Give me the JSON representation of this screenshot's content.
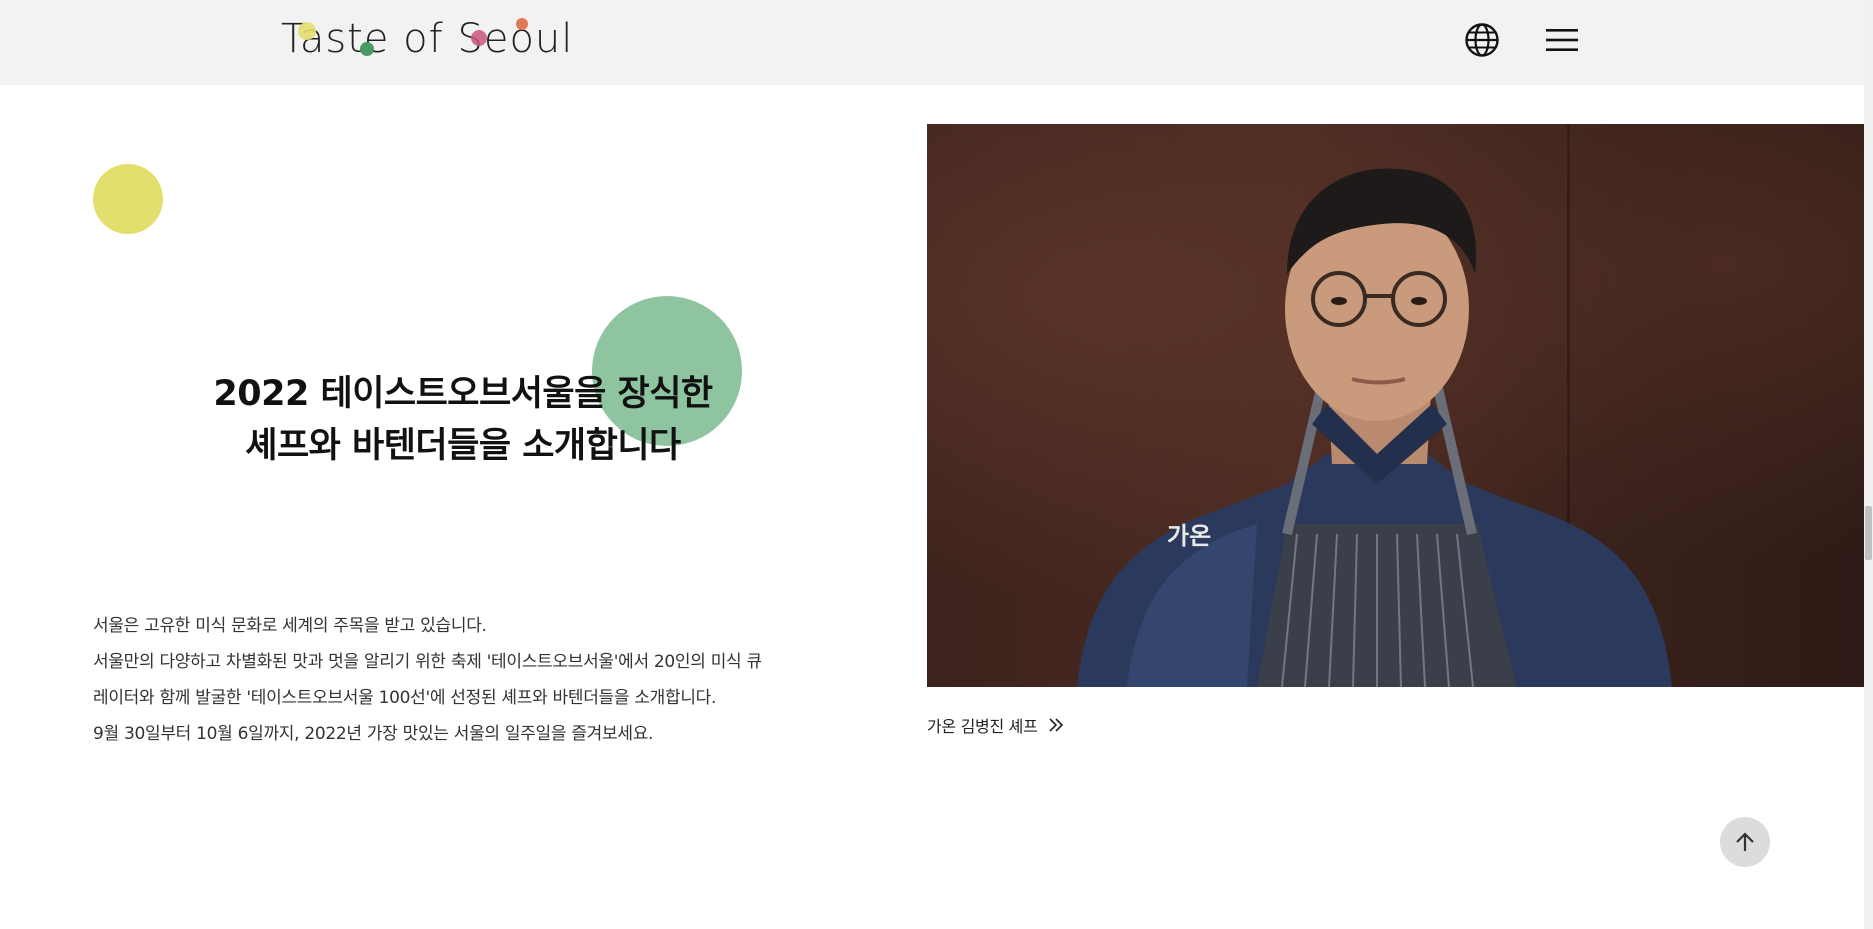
{
  "header": {
    "logo_text": "Taste of Seoul",
    "logo_dot_colors": [
      "#e2df6d",
      "#4a9a63",
      "#c9577a",
      "#e07a55"
    ],
    "language_icon": "globe-icon",
    "menu_icon": "hamburger-menu-icon",
    "background": "#f2f2f2"
  },
  "intro": {
    "headline_line1": "2022 테이스트오브서울을 장식한",
    "headline_line2": "셰프와 바텐더들을 소개합니다",
    "desc_line1": "서울은 고유한 미식 문화로 세계의 주목을 받고 있습니다.",
    "desc_line2": "서울만의 다양하고 차별화된 맛과 멋을 알리기 위한 축제 '테이스트오브서울'에서 20인의 미식 큐",
    "desc_line3": "레이터와 함께 발굴한 '테이스트오브서울 100선'에 선정된 셰프와 바텐더들을 소개합니다.",
    "desc_line4": "9월 30일부터 10월 6일까지, 2022년 가장 맛있는 서울의 일주일을 즐겨보세요.",
    "accent_yellow": "#e2df6d",
    "accent_green": "#8fc4a0"
  },
  "feature": {
    "photo_subject": "chef portrait",
    "caption": "가온 김병진 셰프",
    "caption_icon": "double-chevron-right-icon"
  },
  "scroll_top": {
    "icon": "arrow-up-icon"
  }
}
